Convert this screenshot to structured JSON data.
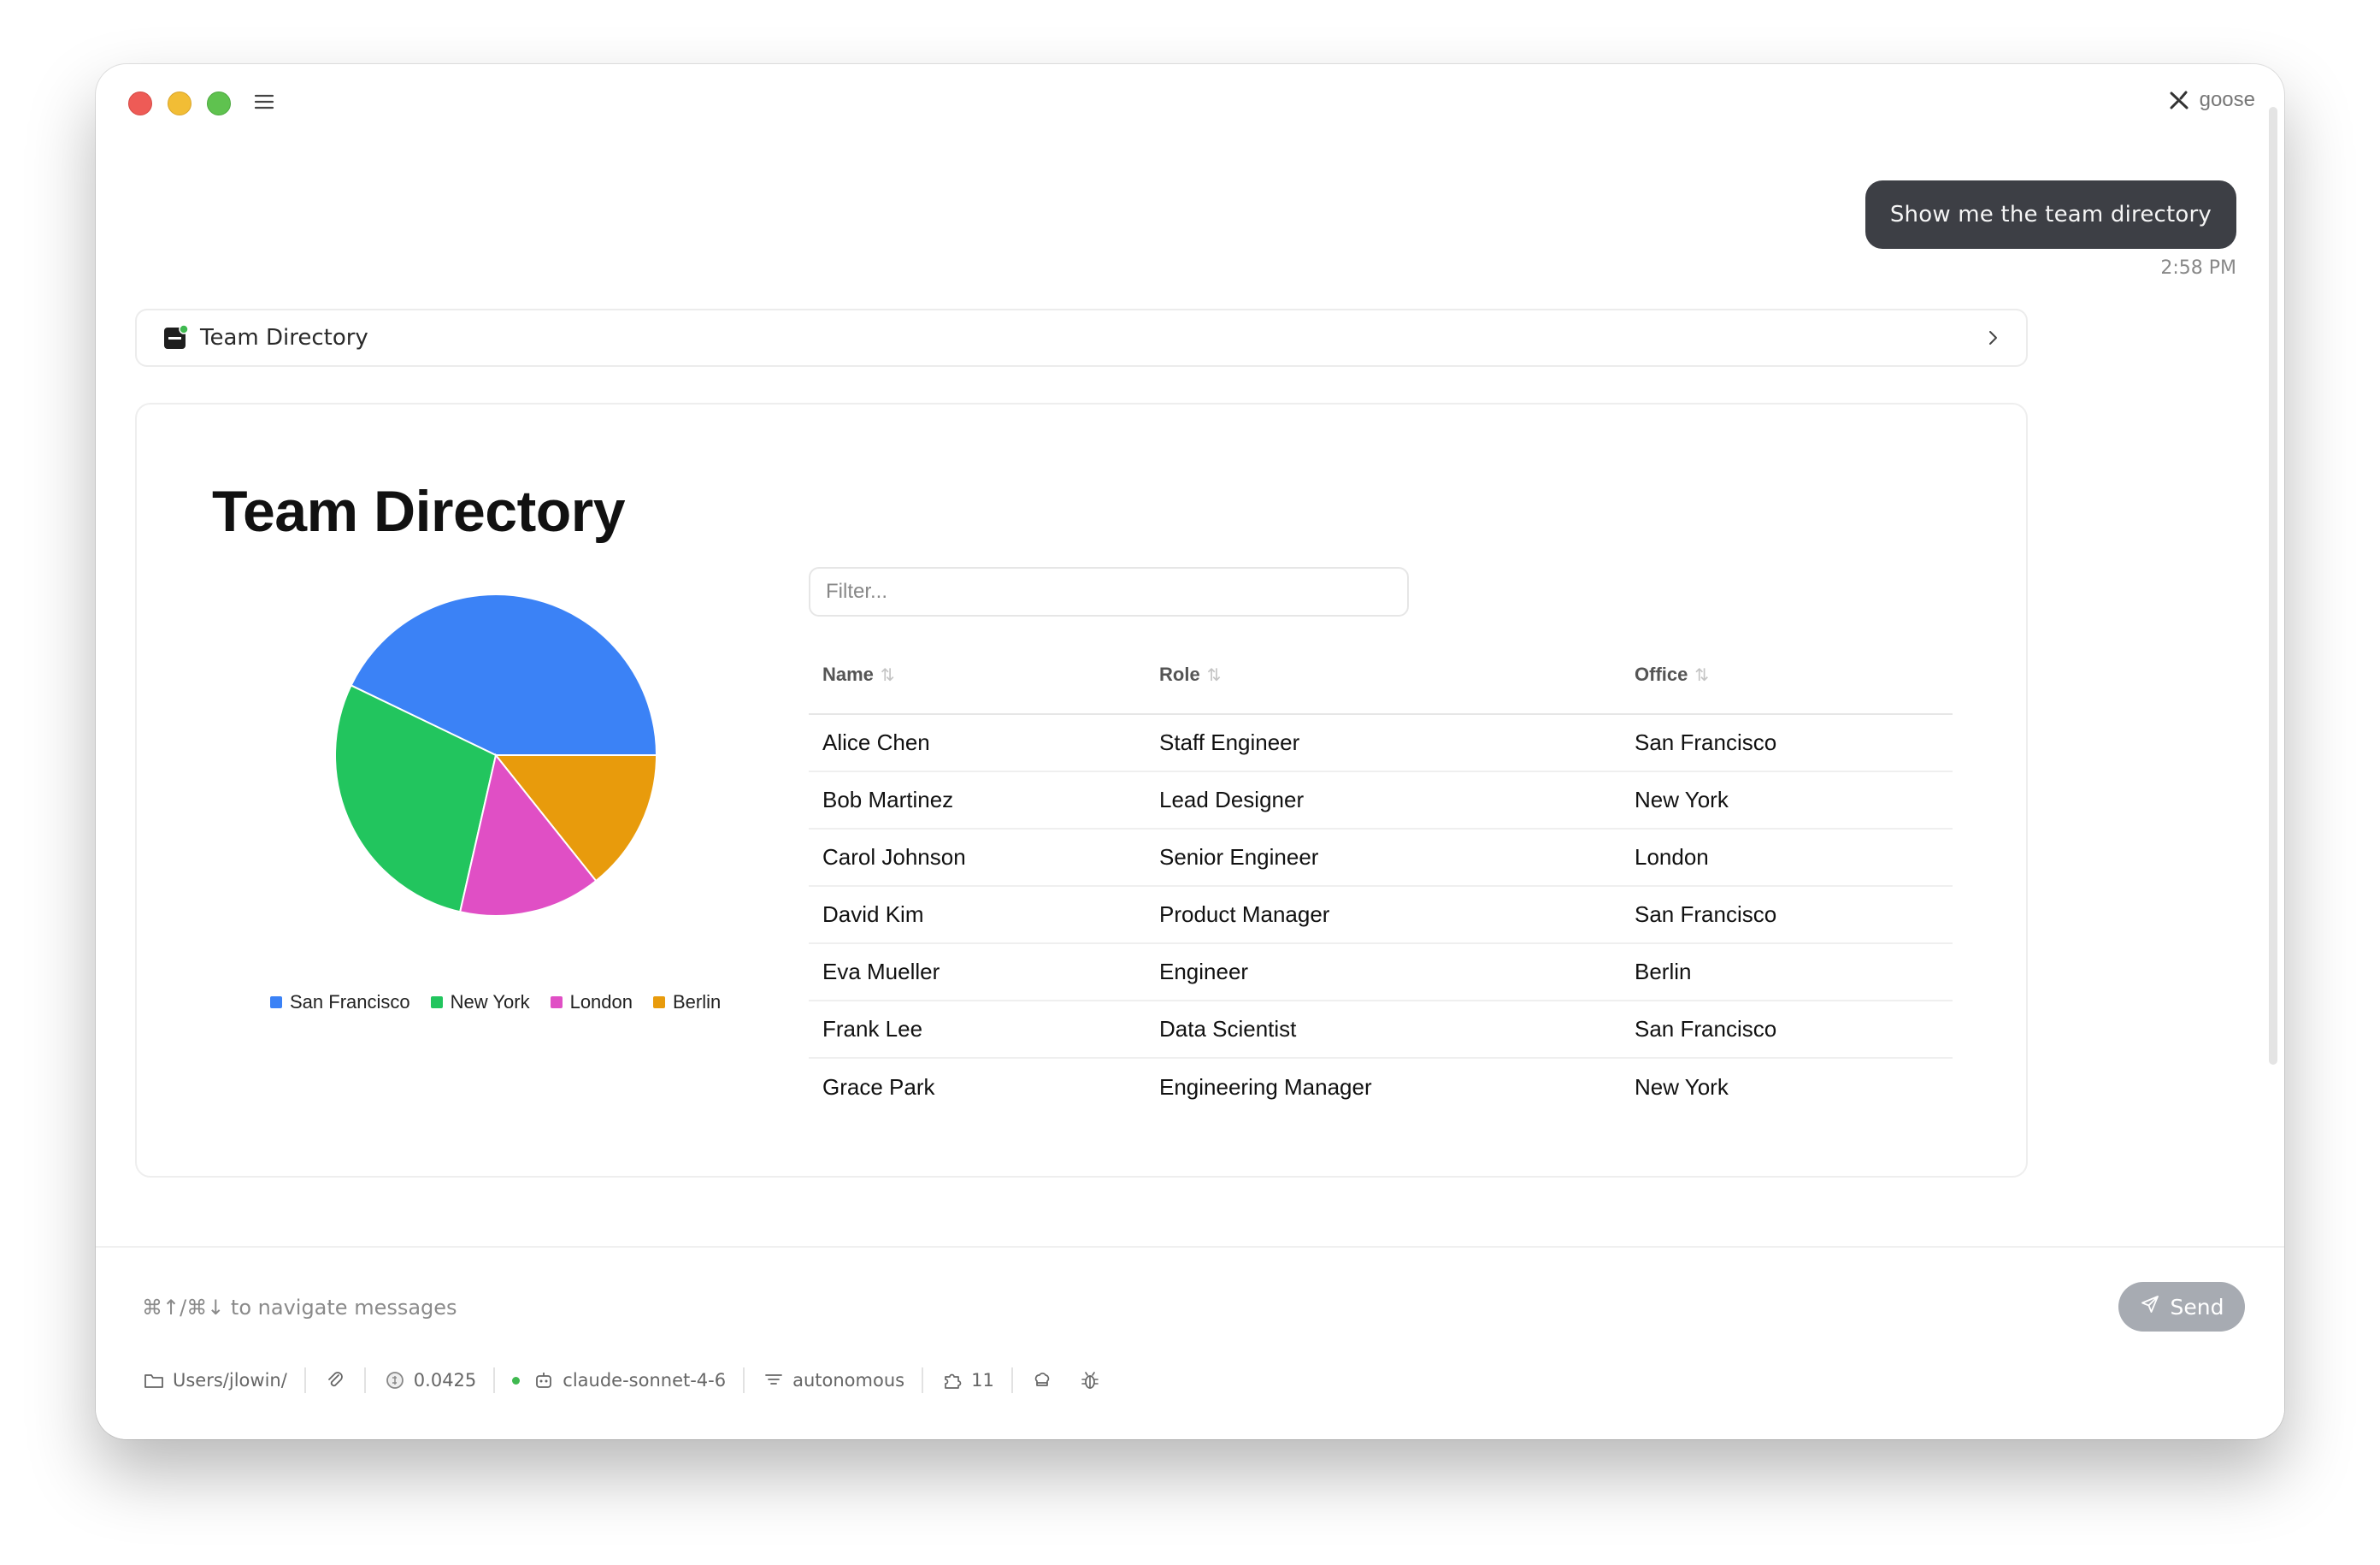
{
  "app": {
    "brand": "goose"
  },
  "chat": {
    "user_message": "Show me the team directory",
    "user_time": "2:58 PM"
  },
  "tool": {
    "title": "Team Directory"
  },
  "card": {
    "title": "Team Directory",
    "filter_placeholder": "Filter...",
    "columns": [
      "Name",
      "Role",
      "Office"
    ],
    "rows": [
      [
        "Alice Chen",
        "Staff Engineer",
        "San Francisco"
      ],
      [
        "Bob Martinez",
        "Lead Designer",
        "New York"
      ],
      [
        "Carol Johnson",
        "Senior Engineer",
        "London"
      ],
      [
        "David Kim",
        "Product Manager",
        "San Francisco"
      ],
      [
        "Eva Mueller",
        "Engineer",
        "Berlin"
      ],
      [
        "Frank Lee",
        "Data Scientist",
        "San Francisco"
      ],
      [
        "Grace Park",
        "Engineering Manager",
        "New York"
      ]
    ]
  },
  "chart_data": {
    "type": "pie",
    "categories": [
      "San Francisco",
      "New York",
      "London",
      "Berlin"
    ],
    "values": [
      3,
      2,
      1,
      1
    ],
    "colors": [
      "#3b82f6",
      "#22c55e",
      "#e04fc5",
      "#e89b0c"
    ],
    "legend_position": "bottom"
  },
  "composer": {
    "hint": "⌘↑/⌘↓ to navigate messages",
    "send_label": "Send",
    "path": "Users/jlowin/",
    "cost": "0.0425",
    "model": "claude-sonnet-4-6",
    "mode": "autonomous",
    "extensions_count": "11"
  }
}
